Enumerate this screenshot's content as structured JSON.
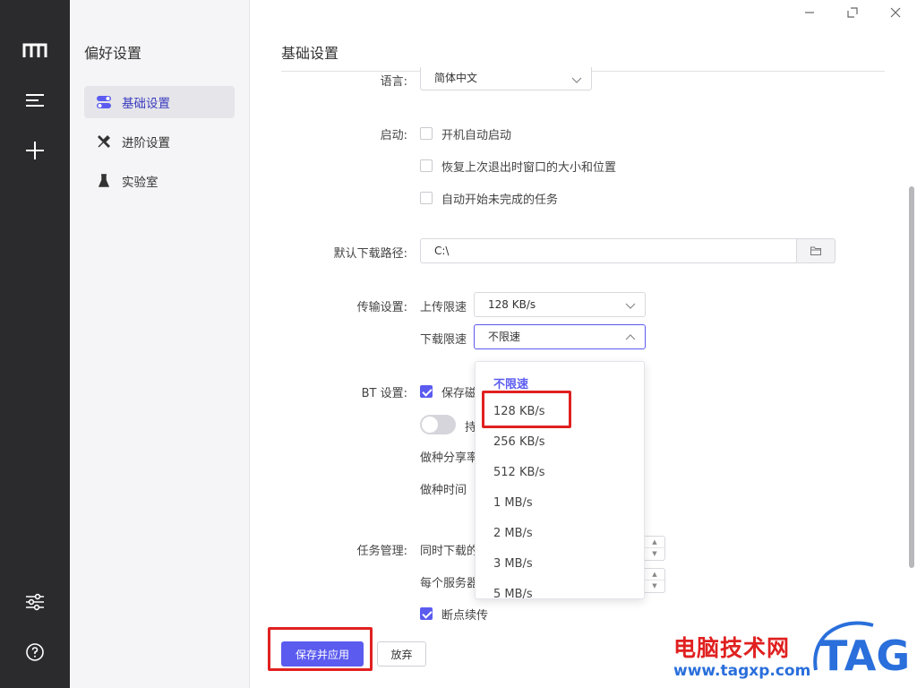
{
  "sidebar": {
    "title": "偏好设置",
    "items": [
      {
        "label": "基础设置"
      },
      {
        "label": "进阶设置"
      },
      {
        "label": "实验室"
      }
    ]
  },
  "main": {
    "title": "基础设置",
    "language": {
      "label": "语言:",
      "value": "简体中文"
    },
    "startup": {
      "label": "启动:",
      "options": [
        "开机自动启动",
        "恢复上次退出时窗口的大小和位置",
        "自动开始未完成的任务"
      ]
    },
    "download_path": {
      "label": "默认下载路径:",
      "value": "C:\\"
    },
    "transfer": {
      "label": "传输设置:",
      "upload_label": "上传限速",
      "upload_value": "128 KB/s",
      "download_label": "下载限速",
      "download_value": "不限速"
    },
    "bt": {
      "label": "BT 设置:",
      "save_label": "保存磁",
      "toggle_label": "持",
      "seed_share_label": "做种分享率",
      "seed_time_label": "做种时间"
    },
    "task": {
      "label": "任务管理:",
      "concurrent_label": "同时下载的",
      "per_server_label": "每个服务器",
      "resume_label": "断点续传"
    }
  },
  "dropdown": {
    "options": [
      "不限速",
      "128 KB/s",
      "256 KB/s",
      "512 KB/s",
      "1 MB/s",
      "2 MB/s",
      "3 MB/s",
      "5 MB/s"
    ],
    "selected": "不限速"
  },
  "footer": {
    "save_label": "保存并应用",
    "cancel_label": "放弃"
  },
  "watermark": {
    "text": "电脑技术网",
    "url": "www.tagxp.com",
    "logo": "TAG"
  },
  "colors": {
    "accent": "#5b5bf0",
    "rail": "#2b2b2d",
    "highlight": "#e02020"
  }
}
